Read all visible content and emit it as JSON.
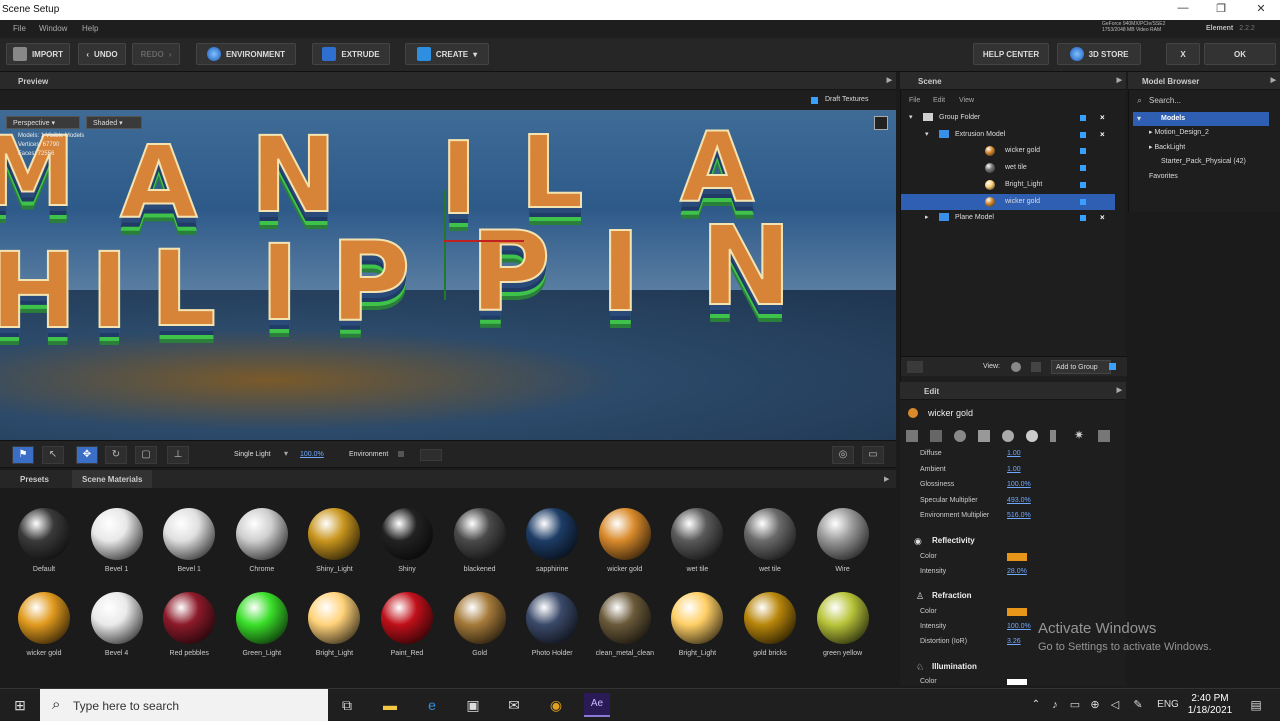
{
  "window": {
    "title": "Scene Setup",
    "minimize": "—",
    "maximize": "❐",
    "close": "✕"
  },
  "menu": [
    "File",
    "Window",
    "Help"
  ],
  "gpu_info": [
    "GeForce 940MX/PCIe/SSE2",
    "1753/2048 MB Video RAM"
  ],
  "element": {
    "name": "Element",
    "version": "2.2.2"
  },
  "toolbar": {
    "import": "IMPORT",
    "undo": "UNDO",
    "redo": "REDO",
    "environment": "ENVIRONMENT",
    "extrude": "EXTRUDE",
    "create": "CREATE",
    "help_center": "HELP CENTER",
    "store": "3D STORE",
    "close": "X",
    "ok": "OK"
  },
  "preview": {
    "title": "Preview",
    "draft_textures": "Draft Textures",
    "camera": "Perspective",
    "shading": "Shaded",
    "stats": [
      "Models: 1 Visible Models",
      "Vertices: 67790",
      "Faces: 72556"
    ],
    "letters_row1": [
      "M",
      "A",
      "N",
      "I",
      "L",
      "A"
    ],
    "letters_row2": [
      "H",
      "I",
      "L",
      "I",
      "P",
      "P",
      "I",
      "N"
    ]
  },
  "viewport_bar": {
    "light": "Single Light",
    "light_pct": "100.0%",
    "environment": "Environment"
  },
  "presets": {
    "tabs": [
      "Presets",
      "Scene Materials"
    ],
    "materials": [
      {
        "name": "Default",
        "color": "#3a3a3a"
      },
      {
        "name": "Bevel 1",
        "color": "#e8e8e8"
      },
      {
        "name": "Bevel 1",
        "color": "#e0e0e0"
      },
      {
        "name": "Chrome",
        "color": "#cfcfcf"
      },
      {
        "name": "Shiny_Light",
        "color": "#c9961f"
      },
      {
        "name": "Shiny",
        "color": "#222222"
      },
      {
        "name": "blackened",
        "color": "#4a4a4a"
      },
      {
        "name": "sapphirine",
        "color": "#1d3c66"
      },
      {
        "name": "wicker gold",
        "color": "#d98a2b"
      },
      {
        "name": "wet tile",
        "color": "#5a5a5a"
      },
      {
        "name": "wet tile",
        "color": "#6a6a6a"
      },
      {
        "name": "Wire",
        "color": "#9a9a9a"
      },
      {
        "name": "wicker gold",
        "color": "#e19a1e"
      },
      {
        "name": "Bevel 4",
        "color": "#eaeaea"
      },
      {
        "name": "Red pebbles",
        "color": "#8c1a2a"
      },
      {
        "name": "Green_Light",
        "color": "#3adf2a"
      },
      {
        "name": "Bright_Light",
        "color": "#ffd27a"
      },
      {
        "name": "Paint_Red",
        "color": "#c0101a"
      },
      {
        "name": "Gold",
        "color": "#a57a3a"
      },
      {
        "name": "Photo Holder",
        "color": "#3b4a6a"
      },
      {
        "name": "clean_metal_clean",
        "color": "#6a5a3a"
      },
      {
        "name": "Bright_Light",
        "color": "#ffcf66"
      },
      {
        "name": "gold bricks",
        "color": "#b8860b"
      },
      {
        "name": "green yellow",
        "color": "#b8c43a"
      }
    ]
  },
  "scene": {
    "title": "Scene",
    "menu": [
      "File",
      "Edit",
      "View"
    ],
    "items": [
      {
        "name": "Group Folder",
        "indent": 0,
        "ball": "",
        "sel": false,
        "x": true
      },
      {
        "name": "Extrusion Model",
        "indent": 1,
        "ball": "",
        "sel": false,
        "x": true
      },
      {
        "name": "wicker gold",
        "indent": 2,
        "ball": "#d98a2b",
        "sel": false,
        "x": false
      },
      {
        "name": "wet tile",
        "indent": 2,
        "ball": "#777777",
        "sel": false,
        "x": false
      },
      {
        "name": "Bright_Light",
        "indent": 2,
        "ball": "#ffd27a",
        "sel": false,
        "x": false
      },
      {
        "name": "wicker gold",
        "indent": 2,
        "ball": "#d98a2b",
        "sel": true,
        "x": false
      },
      {
        "name": "Plane Model",
        "indent": 1,
        "ball": "",
        "sel": false,
        "x": true
      }
    ],
    "view_label": "View:",
    "add_to_group": "Add to Group"
  },
  "model_browser": {
    "title": "Model Browser",
    "search_placeholder": "Search...",
    "items": [
      "Models",
      "Motion_Design_2",
      "BackLight",
      "Starter_Pack_Physical (42)",
      "Favorites"
    ]
  },
  "edit": {
    "title": "Edit",
    "material": "wicker gold",
    "props": [
      {
        "label": "Diffuse",
        "value": "1.00"
      },
      {
        "label": "Ambient",
        "value": "1.00"
      },
      {
        "label": "Glossiness",
        "value": "100.0%"
      },
      {
        "label": "Specular Multiplier",
        "value": "493.0%"
      },
      {
        "label": "Environment Multiplier",
        "value": "516.0%"
      }
    ],
    "reflectivity": {
      "title": "Reflectivity",
      "color_label": "Color",
      "intensity_label": "Intensity",
      "intensity": "28.0%",
      "color": "#e8961a"
    },
    "refraction": {
      "title": "Refraction",
      "color_label": "Color",
      "intensity_label": "Intensity",
      "intensity": "100.0%",
      "distortion_label": "Distortion (IoR)",
      "distortion": "3.26",
      "color": "#e8961a"
    },
    "illumination": {
      "title": "Illumination",
      "color_label": "Color",
      "color": "#ffffff"
    }
  },
  "watermark": {
    "line1": "Activate Windows",
    "line2": "Go to Settings to activate Windows."
  },
  "taskbar": {
    "search_placeholder": "Type here to search",
    "lang": "ENG",
    "time": "2:40 PM",
    "date": "1/18/2021"
  }
}
